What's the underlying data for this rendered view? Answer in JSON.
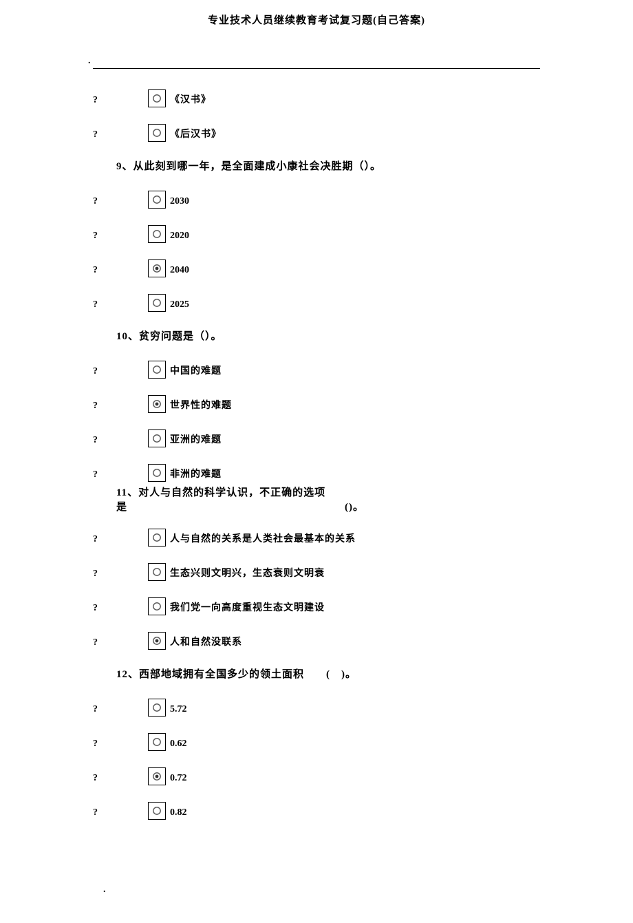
{
  "header": {
    "title": "专业技术人员继续教育考试复习题(自己答案)"
  },
  "marks": {
    "qmark": "?",
    "dot": "."
  },
  "options_pre9": [
    {
      "label": "《汉书》",
      "selected": false
    },
    {
      "label": "《后汉书》",
      "selected": false
    }
  ],
  "q9": {
    "text": "9、从此刻到哪一年，是全面建成小康社会决胜期（）。",
    "options": [
      {
        "label": "2030",
        "selected": false
      },
      {
        "label": "2020",
        "selected": false
      },
      {
        "label": "2040",
        "selected": true
      },
      {
        "label": "2025",
        "selected": false
      }
    ]
  },
  "q10": {
    "text": "10、贫穷问题是（）。",
    "options": [
      {
        "label": "中国的难题",
        "selected": false
      },
      {
        "label": "世界性的难题",
        "selected": true
      },
      {
        "label": "亚洲的难题",
        "selected": false
      },
      {
        "label": "非洲的难题",
        "selected": false
      }
    ]
  },
  "q11": {
    "line1": "11、对人与自然的科学认识，不正确的选项",
    "line2_left": "是",
    "line2_right": "()。",
    "options": [
      {
        "label": "人与自然的关系是人类社会最基本的关系",
        "selected": false
      },
      {
        "label": "生态兴则文明兴，生态衰则文明衰",
        "selected": false
      },
      {
        "label": "我们党一向高度重视生态文明建设",
        "selected": false
      },
      {
        "label": "人和自然没联系",
        "selected": true
      }
    ]
  },
  "q12": {
    "text": "12、西部地域拥有全国多少的领土面积  ( )。",
    "options": [
      {
        "label": "5.72",
        "selected": false
      },
      {
        "label": "0.62",
        "selected": false
      },
      {
        "label": "0.72",
        "selected": true
      },
      {
        "label": "0.82",
        "selected": false
      }
    ]
  }
}
